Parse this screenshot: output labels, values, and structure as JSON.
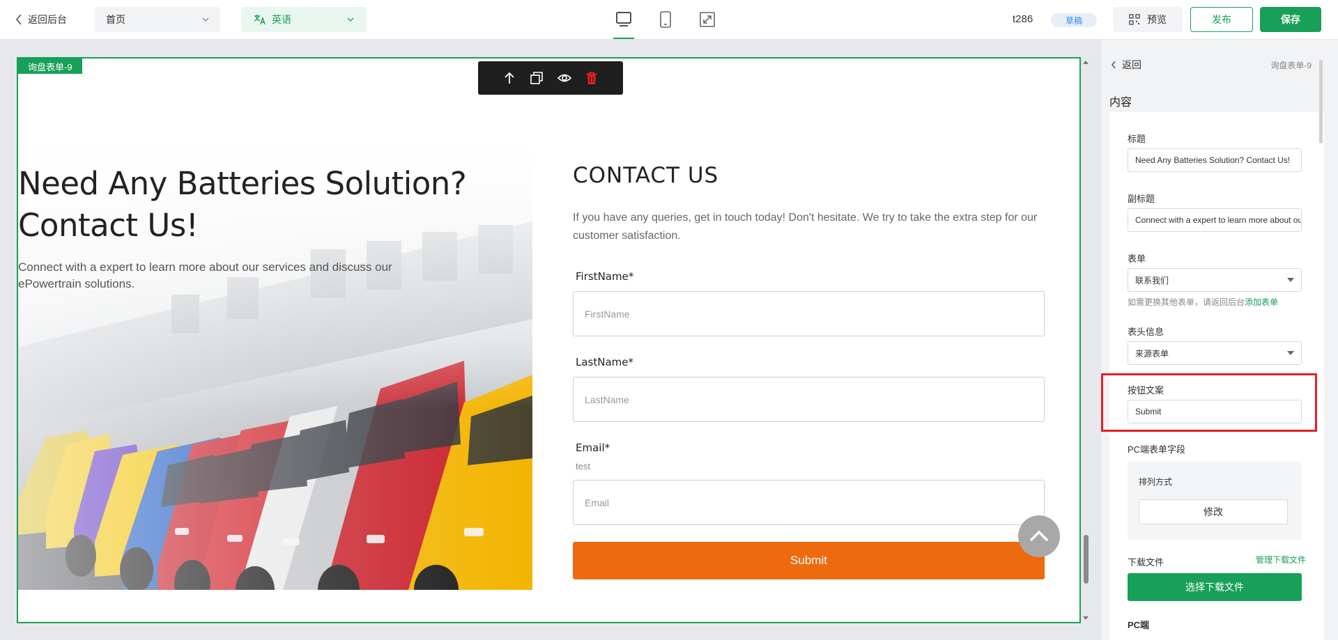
{
  "topbar": {
    "back_label": "返回后台",
    "page_select": "首页",
    "language_select": "英语",
    "site_name": "t286",
    "status_badge": "草稿",
    "preview_label": "预览",
    "publish_label": "发布",
    "save_label": "保存"
  },
  "canvas": {
    "module_tag": "询盘表单-9",
    "hero": {
      "title": "Need Any Batteries Solution? Contact Us!",
      "subtitle": "Connect with a expert to learn more about our services and discuss our ePowertrain solutions."
    },
    "contact": {
      "title": "CONTACT US",
      "description": "If you have any queries, get in touch today! Don't hesitate. We try to take the extra step for our customer satisfaction.",
      "fields": [
        {
          "label": "FirstName*",
          "placeholder": "FirstName",
          "note": ""
        },
        {
          "label": "LastName*",
          "placeholder": "LastName",
          "note": ""
        },
        {
          "label": "Email*",
          "placeholder": "Email",
          "note": "test"
        }
      ],
      "submit_label": "Submit"
    }
  },
  "panel": {
    "back_label": "返回",
    "breadcrumb": "询盘表单-9",
    "section_title": "内容",
    "title_label": "标题",
    "title_value": "Need Any Batteries Solution? Contact Us!",
    "subtitle_label": "副标题",
    "subtitle_value": "Connect with a  expert to learn more about our services",
    "form_label": "表单",
    "form_value": "联系我们",
    "form_hint": "如需更换其他表单，请返回后台",
    "form_hint_link": "添加表单",
    "header_info_label": "表头信息",
    "header_info_value": "来源表单",
    "button_text_label": "按钮文案",
    "button_text_value": "Submit",
    "pc_fields_label": "PC端表单字段",
    "arrangement_label": "排列方式",
    "modify_label": "修改",
    "download_label": "下载文件",
    "manage_download_label": "管理下载文件",
    "choose_download_label": "选择下载文件",
    "pc_label_partial": "PC端"
  },
  "colors": {
    "accent": "#18a058",
    "submit": "#ee6a0f",
    "highlight": "#e0202b"
  }
}
